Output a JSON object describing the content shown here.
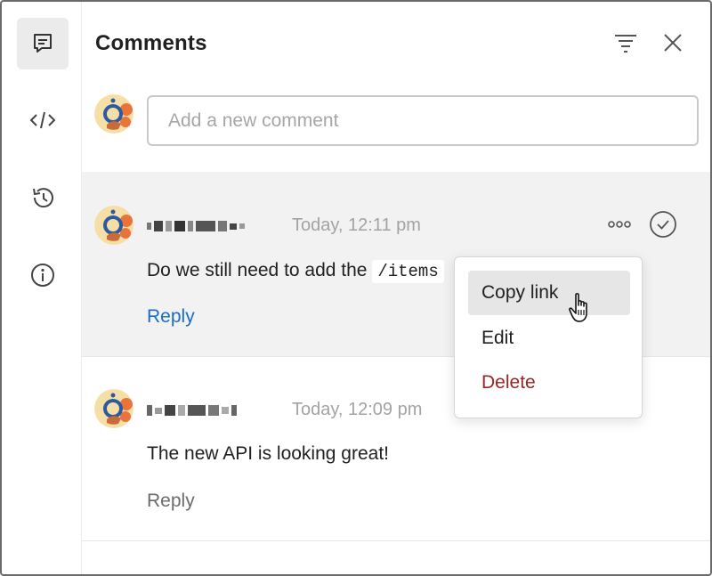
{
  "header": {
    "title": "Comments"
  },
  "sidebar": {
    "items": [
      {
        "icon": "comment-icon",
        "active": true
      },
      {
        "icon": "code-icon",
        "active": false
      },
      {
        "icon": "history-icon",
        "active": false
      },
      {
        "icon": "info-icon",
        "active": false
      }
    ]
  },
  "new_comment": {
    "placeholder": "Add a new comment"
  },
  "comments": [
    {
      "author": "[blurred]",
      "time": "Today, 12:11 pm",
      "text_before": "Do we still need to add the ",
      "code": "/items",
      "reply_label": "Reply"
    },
    {
      "author": "[blurred]",
      "time": "Today, 12:09 pm",
      "text": "The new API is looking great!",
      "reply_label": "Reply"
    }
  ],
  "context_menu": {
    "items": [
      {
        "label": "Copy link",
        "hovered": true
      },
      {
        "label": "Edit"
      },
      {
        "label": "Delete",
        "danger": true
      }
    ]
  },
  "colors": {
    "accent_link": "#1a6cc7",
    "danger": "#9b2424",
    "selected_bg": "#f2f2f2"
  }
}
